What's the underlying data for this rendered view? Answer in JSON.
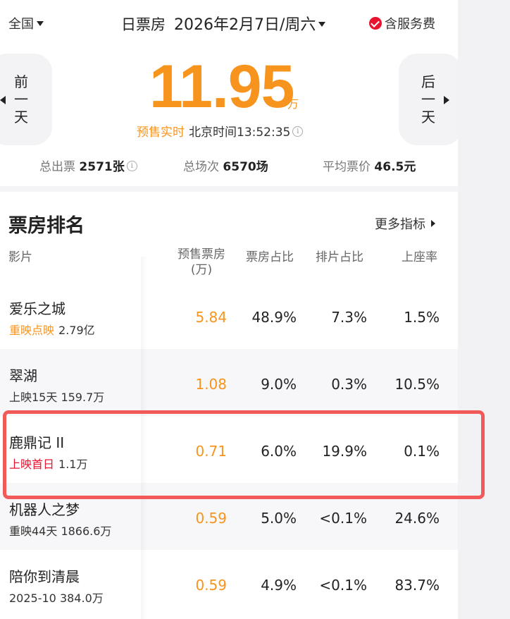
{
  "header": {
    "region": "全国",
    "label": "日票房",
    "date": "2026年2月7日/周六",
    "service_fee": "含服务费",
    "prev_day": [
      "前",
      "一",
      "天"
    ],
    "next_day": [
      "后",
      "一",
      "天"
    ],
    "total": "11.95",
    "unit": "万",
    "presale": "预售实时",
    "beijing_time": "北京时间13:52:35"
  },
  "stats": {
    "tickets_label": "总出票",
    "tickets_value": "2571张",
    "shows_label": "总场次",
    "shows_value": "6570场",
    "avg_label": "平均票价",
    "avg_value": "46.5元"
  },
  "ranking": {
    "title": "票房排名",
    "more": "更多指标",
    "columns": {
      "film": "影片",
      "presale": "预售票房",
      "presale_unit": "(万)",
      "share": "票房占比",
      "schedule": "排片占比",
      "occupancy": "上座率"
    },
    "rows": [
      {
        "name": "爱乐之城",
        "tag": "重映点映",
        "tag_color": "#f7941d",
        "sub": "2.79亿",
        "presale": "5.84",
        "share": "48.9%",
        "schedule": "7.3%",
        "occupancy": "1.5%"
      },
      {
        "name": "翠湖",
        "tag": "",
        "tag_color": "",
        "sub": "上映15天 159.7万",
        "presale": "1.08",
        "share": "9.0%",
        "schedule": "0.3%",
        "occupancy": "10.5%"
      },
      {
        "name": "鹿鼎记 II",
        "tag": "上映首日",
        "tag_color": "#e8142f",
        "sub": "1.1万",
        "presale": "0.71",
        "share": "6.0%",
        "schedule": "19.9%",
        "occupancy": "0.1%"
      },
      {
        "name": "机器人之梦",
        "tag": "",
        "tag_color": "",
        "sub": "重映44天 1866.6万",
        "presale": "0.59",
        "share": "5.0%",
        "schedule": "<0.1%",
        "occupancy": "24.6%"
      },
      {
        "name": "陪你到清晨",
        "tag": "",
        "tag_color": "",
        "sub": "2025-10 384.0万",
        "presale": "0.59",
        "share": "4.9%",
        "schedule": "<0.1%",
        "occupancy": "83.7%"
      }
    ]
  },
  "colors": {
    "accent": "#f7941d",
    "red": "#e8142f",
    "highlight": "#f25a5a"
  }
}
